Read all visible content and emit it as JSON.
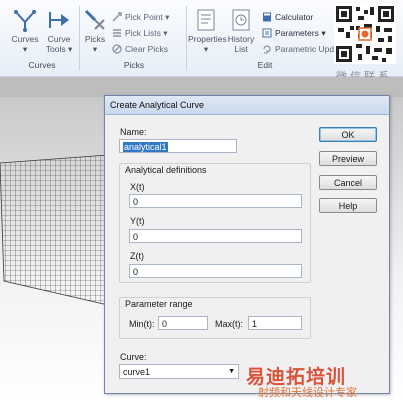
{
  "ribbon": {
    "curves_group": {
      "label": "Curves",
      "curves_button": "Curves",
      "curve_tools_button_line1": "Curve",
      "curve_tools_button_line2": "Tools",
      "dropdown_glyph": "▾"
    },
    "picks_group": {
      "label": "Picks",
      "picks_button": "Picks",
      "pick_point": "Pick Point",
      "pick_lists": "Pick Lists",
      "clear_picks": "Clear Picks",
      "dropdown_glyph": "▾"
    },
    "edit_group": {
      "label": "Edit",
      "properties_button": "Properties",
      "history_list_line1": "History",
      "history_list_line2": "List",
      "calculator": "Calculator",
      "parameters": "Parameters",
      "parametric_update": "Parametric Upd",
      "dropdown_glyph": "▾"
    },
    "watermark_text": "微信联系"
  },
  "dialog": {
    "title": "Create Analytical Curve",
    "name_label": "Name:",
    "name_value": "analytical1",
    "analytical_definitions_label": "Analytical definitions",
    "xt_label": "X(t)",
    "xt_value": "0",
    "yt_label": "Y(t)",
    "yt_value": "0",
    "zt_label": "Z(t)",
    "zt_value": "0",
    "parameter_range_label": "Parameter range",
    "min_label": "Min(t):",
    "min_value": "0",
    "max_label": "Max(t):",
    "max_value": "1",
    "curve_label": "Curve:",
    "curve_value": "curve1",
    "ok_button": "OK",
    "preview_button": "Preview",
    "cancel_button": "Cancel",
    "help_button": "Help"
  },
  "site_watermark": {
    "line1": "易迪拓培训",
    "line2": "射频和天线设计专家"
  },
  "colors": {
    "ribbon_icon_blue": "#3d6fa8",
    "selection_blue": "#3178c6",
    "watermark_red": "#d9533a"
  }
}
